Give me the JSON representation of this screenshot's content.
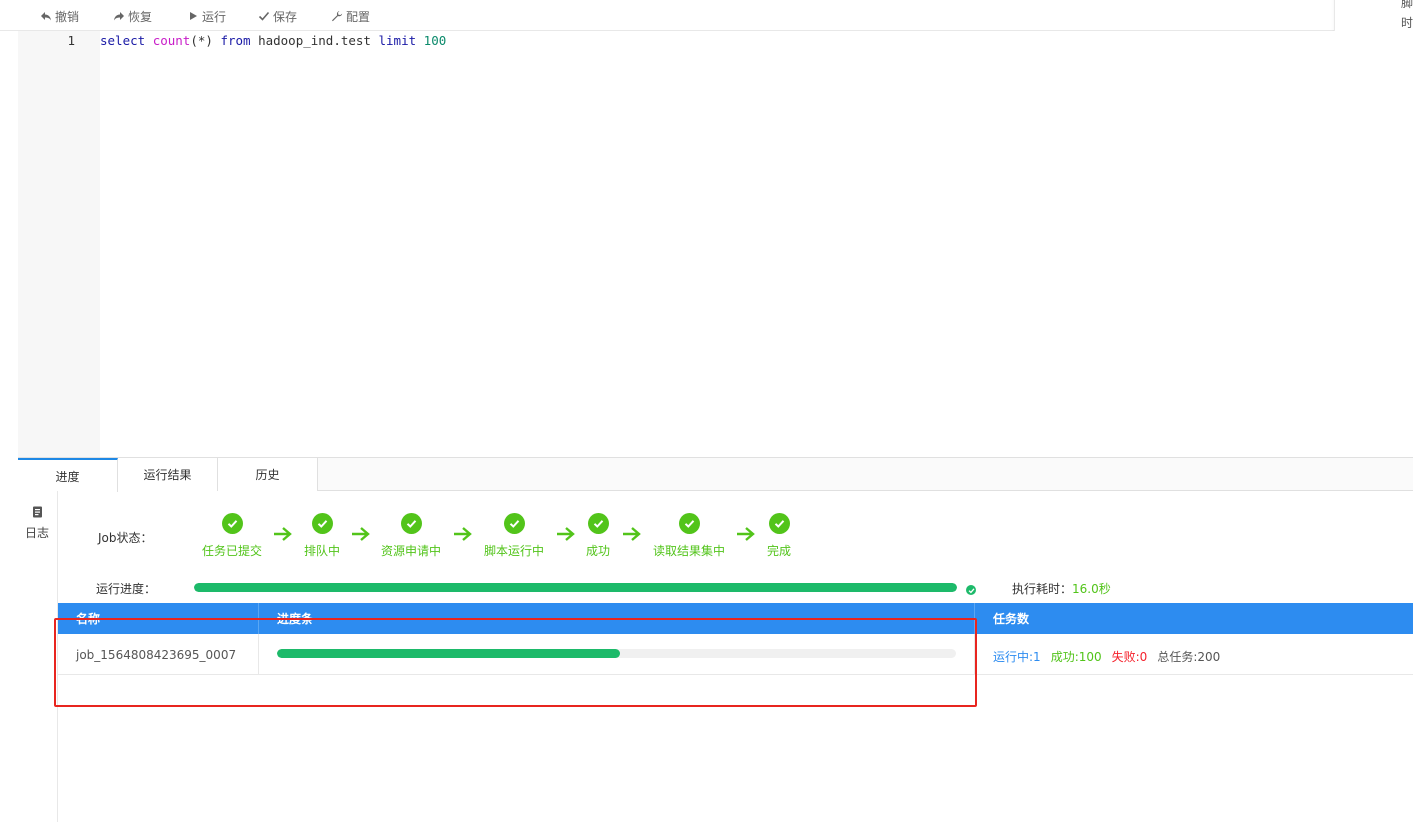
{
  "toolbar": {
    "undo_label": "撤销",
    "redo_label": "恢复",
    "run_label": "运行",
    "save_label": "保存",
    "config_label": "配置"
  },
  "corner_tip": {
    "line1": "脚",
    "line2": "时"
  },
  "editor": {
    "line_number": "1",
    "tokens": {
      "t1": "select",
      "t2": "count",
      "t3": "(*)",
      "t4": "from",
      "t5": "hadoop_ind.test",
      "t6": "limit",
      "t7": "100"
    }
  },
  "tabs": [
    {
      "label": "进度",
      "active": true
    },
    {
      "label": "运行结果",
      "active": false
    },
    {
      "label": "历史",
      "active": false
    }
  ],
  "log_strip": {
    "label": "日志"
  },
  "job_status": {
    "label": "Job状态：",
    "steps": [
      {
        "label": "任务已提交"
      },
      {
        "label": "排队中"
      },
      {
        "label": "资源申请中"
      },
      {
        "label": "脚本运行中"
      },
      {
        "label": "成功"
      },
      {
        "label": "读取结果集中"
      },
      {
        "label": "完成"
      }
    ]
  },
  "run_progress": {
    "label": "运行进度：",
    "percent": 100,
    "exec_time_label": "执行耗时：",
    "exec_time_value": "16.0秒"
  },
  "table": {
    "headers": {
      "name": "名称",
      "progress": "进度条",
      "tasks": "任务数"
    },
    "rows": [
      {
        "name": "job_1564808423695_0007",
        "progress_fraction": 0.505,
        "running": "运行中:1",
        "success": "成功:100",
        "failed": "失败:0",
        "total": "总任务:200"
      }
    ]
  },
  "colors": {
    "accent": "#2d8cf0",
    "success": "#52c41a",
    "progress": "#1dba6a",
    "failed": "#f5222d",
    "highlight": "#e8251f"
  }
}
